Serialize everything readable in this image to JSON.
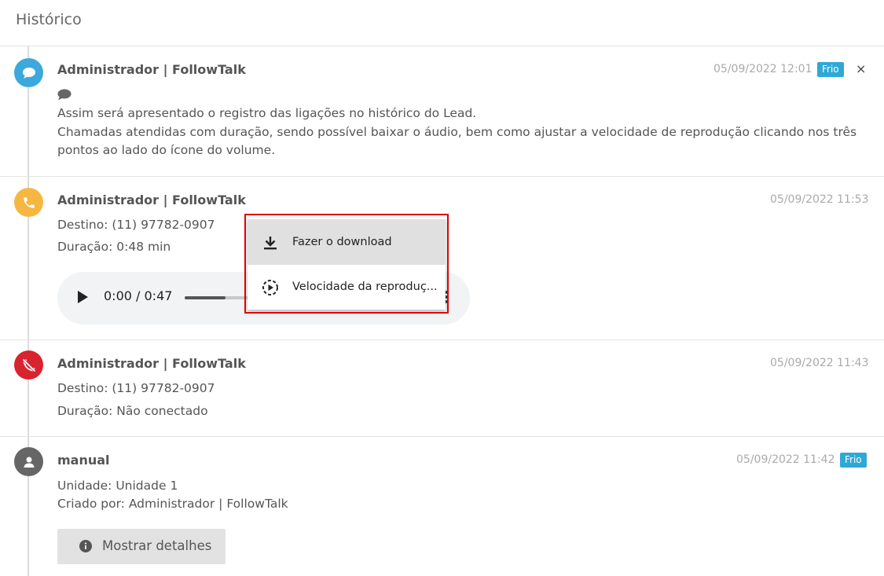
{
  "header": {
    "title": "Histórico"
  },
  "entries": [
    {
      "author": "Administrador | FollowTalk",
      "timestamp": "05/09/2022 12:01",
      "badge": "Frio",
      "close": "×",
      "lines": [
        "Assim será apresentado o registro das ligações no histórico do Lead.",
        "Chamadas atendidas com duração, sendo possível baixar o áudio, bem como ajustar a velocidade de reprodução clicando nos três",
        "pontos ao lado do ícone do volume."
      ]
    },
    {
      "author": "Administrador | FollowTalk",
      "timestamp": "05/09/2022 11:53",
      "lines": [
        "Destino: (11) 97782-0907",
        "Duração: 0:48 min"
      ],
      "audio": {
        "time": "0:00 / 0:47",
        "progress": 0.61
      }
    },
    {
      "author": "Administrador | FollowTalk",
      "timestamp": "05/09/2022 11:43",
      "lines": [
        "Destino: (11) 97782-0907",
        "Duração: Não conectado"
      ]
    },
    {
      "author": "manual",
      "timestamp": "05/09/2022 11:42",
      "badge": "Frio",
      "lines": [
        "Unidade: Unidade 1",
        "Criado por: Administrador | FollowTalk"
      ],
      "details_button": "Mostrar detalhes"
    }
  ],
  "menu": {
    "items": [
      {
        "label": "Fazer o download",
        "icon": "download-icon"
      },
      {
        "label": "Velocidade da reproduç...",
        "icon": "playback-speed-icon"
      }
    ]
  },
  "colors": {
    "badge": "#2ea8d7",
    "chat": "#3ba9db",
    "call": "#f5b742",
    "missed": "#d9232e",
    "user": "#666666",
    "highlight_outline": "#e00000"
  }
}
